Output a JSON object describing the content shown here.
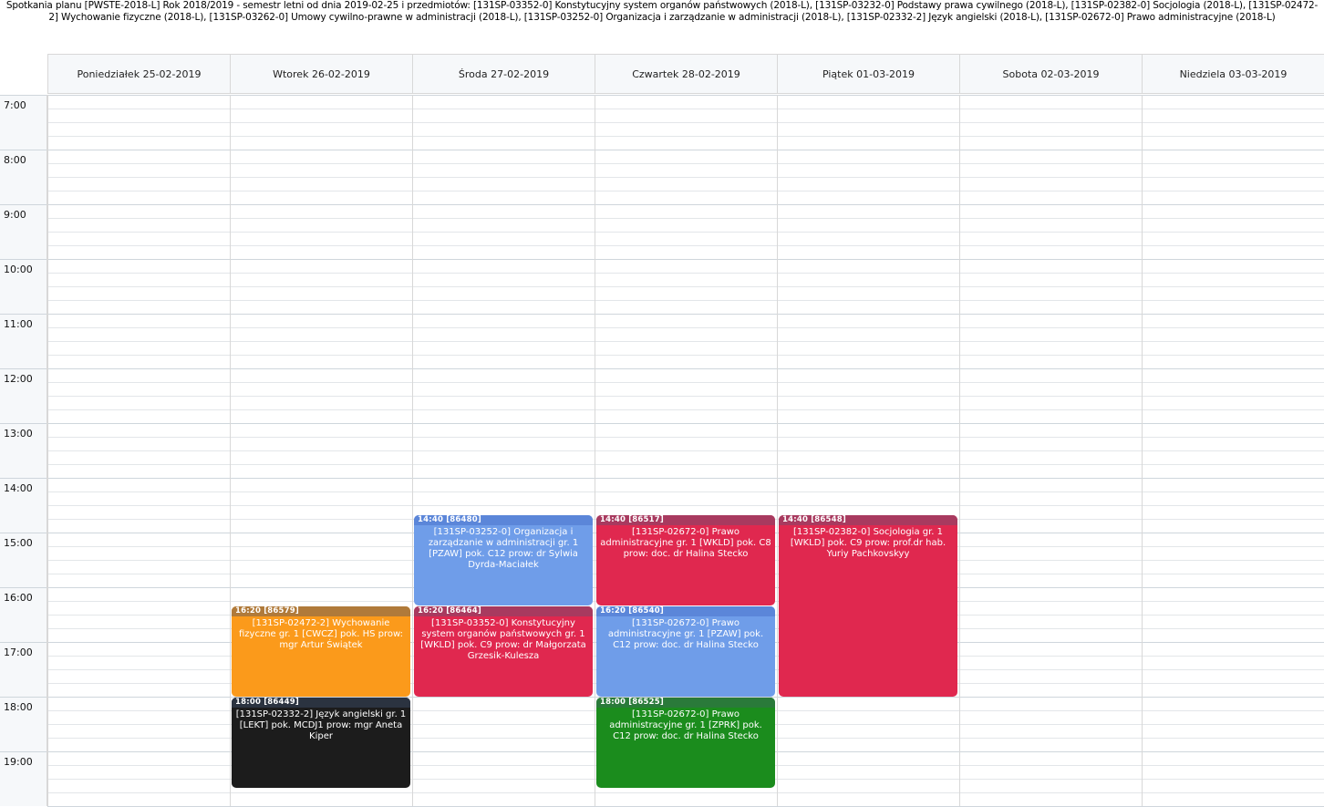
{
  "title": "Spotkania planu [PWSTE-2018-L] Rok 2018/2019 - semestr letni od dnia 2019-02-25 i przedmiotów: [131SP-03352-0] Konstytucyjny system organów państwowych (2018-L), [131SP-03232-0] Podstawy prawa cywilnego (2018-L), [131SP-02382-0] Socjologia (2018-L), [131SP-02472-2] Wychowanie fizyczne (2018-L), [131SP-03262-0] Umowy cywilno-prawne w administracji (2018-L), [131SP-03252-0] Organizacja i zarządzanie w administracji (2018-L), [131SP-02332-2] Język angielski (2018-L), [131SP-02672-0] Prawo administracyjne (2018-L)",
  "days": [
    "Poniedziałek 25-02-2019",
    "Wtorek 26-02-2019",
    "Środa 27-02-2019",
    "Czwartek 28-02-2019",
    "Piątek 01-03-2019",
    "Sobota 02-03-2019",
    "Niedziela 03-03-2019"
  ],
  "hours": [
    "7:00",
    "8:00",
    "9:00",
    "10:00",
    "11:00",
    "12:00",
    "13:00",
    "14:00",
    "15:00",
    "16:00",
    "17:00",
    "18:00",
    "19:00"
  ],
  "events": [
    {
      "day": 2,
      "start": "14:40",
      "end": "16:20",
      "head": "14:40 [86480]",
      "text": "[131SP-03252-0] Organizacja i zarządzanie w administracji gr. 1 [PZAW] pok. C12 prow: dr Sylwia Dyrda-Maciałek",
      "color": "#6f9de9",
      "head_color": "#5b86d9"
    },
    {
      "day": 3,
      "start": "14:40",
      "end": "16:20",
      "head": "14:40 [86517]",
      "text": "[131SP-02672-0] Prawo administracyjne gr. 1 [WKLD] pok. C8 prow: doc. dr Halina Stecko",
      "color": "#e0284f",
      "head_color": "#a83a5f"
    },
    {
      "day": 4,
      "start": "14:40",
      "end": "18:00",
      "head": "14:40 [86548]",
      "text": "[131SP-02382-0] Socjologia gr. 1 [WKLD] pok. C9 prow: prof.dr hab. Yuriy Pachkovskyy",
      "color": "#e0284f",
      "head_color": "#a83a5f"
    },
    {
      "day": 1,
      "start": "16:20",
      "end": "18:00",
      "head": "16:20 [86579]",
      "text": "[131SP-02472-2] Wychowanie fizyczne gr. 1 [CWCZ] pok. HS prow: mgr Artur Świątek",
      "color": "#fb9a1b",
      "head_color": "#b07a3a"
    },
    {
      "day": 2,
      "start": "16:20",
      "end": "18:00",
      "head": "16:20 [86464]",
      "text": "[131SP-03352-0] Konstytucyjny system organów państwowych gr. 1 [WKLD] pok. C9 prow: dr Małgorzata Grzesik-Kulesza",
      "color": "#e0284f",
      "head_color": "#a83a5f"
    },
    {
      "day": 3,
      "start": "16:20",
      "end": "18:00",
      "head": "16:20 [86540]",
      "text": "[131SP-02672-0] Prawo administracyjne gr. 1 [PZAW] pok. C12 prow: doc. dr Halina Stecko",
      "color": "#6f9de9",
      "head_color": "#5b86d9"
    },
    {
      "day": 1,
      "start": "18:00",
      "end": "19:40",
      "head": "18:00 [86449]",
      "text": "[131SP-02332-2] Język angielski gr. 1 [LEKT] pok. MCDJ1 prow: mgr Aneta Kiper",
      "color": "#1c1c1c",
      "head_color": "#2b3340"
    },
    {
      "day": 3,
      "start": "18:00",
      "end": "19:40",
      "head": "18:00 [86525]",
      "text": "[131SP-02672-0] Prawo administracyjne gr. 1 [ZPRK] pok. C12 prow: doc. dr Halina Stecko",
      "color": "#1b8c1d",
      "head_color": "#2a7a3a"
    }
  ]
}
